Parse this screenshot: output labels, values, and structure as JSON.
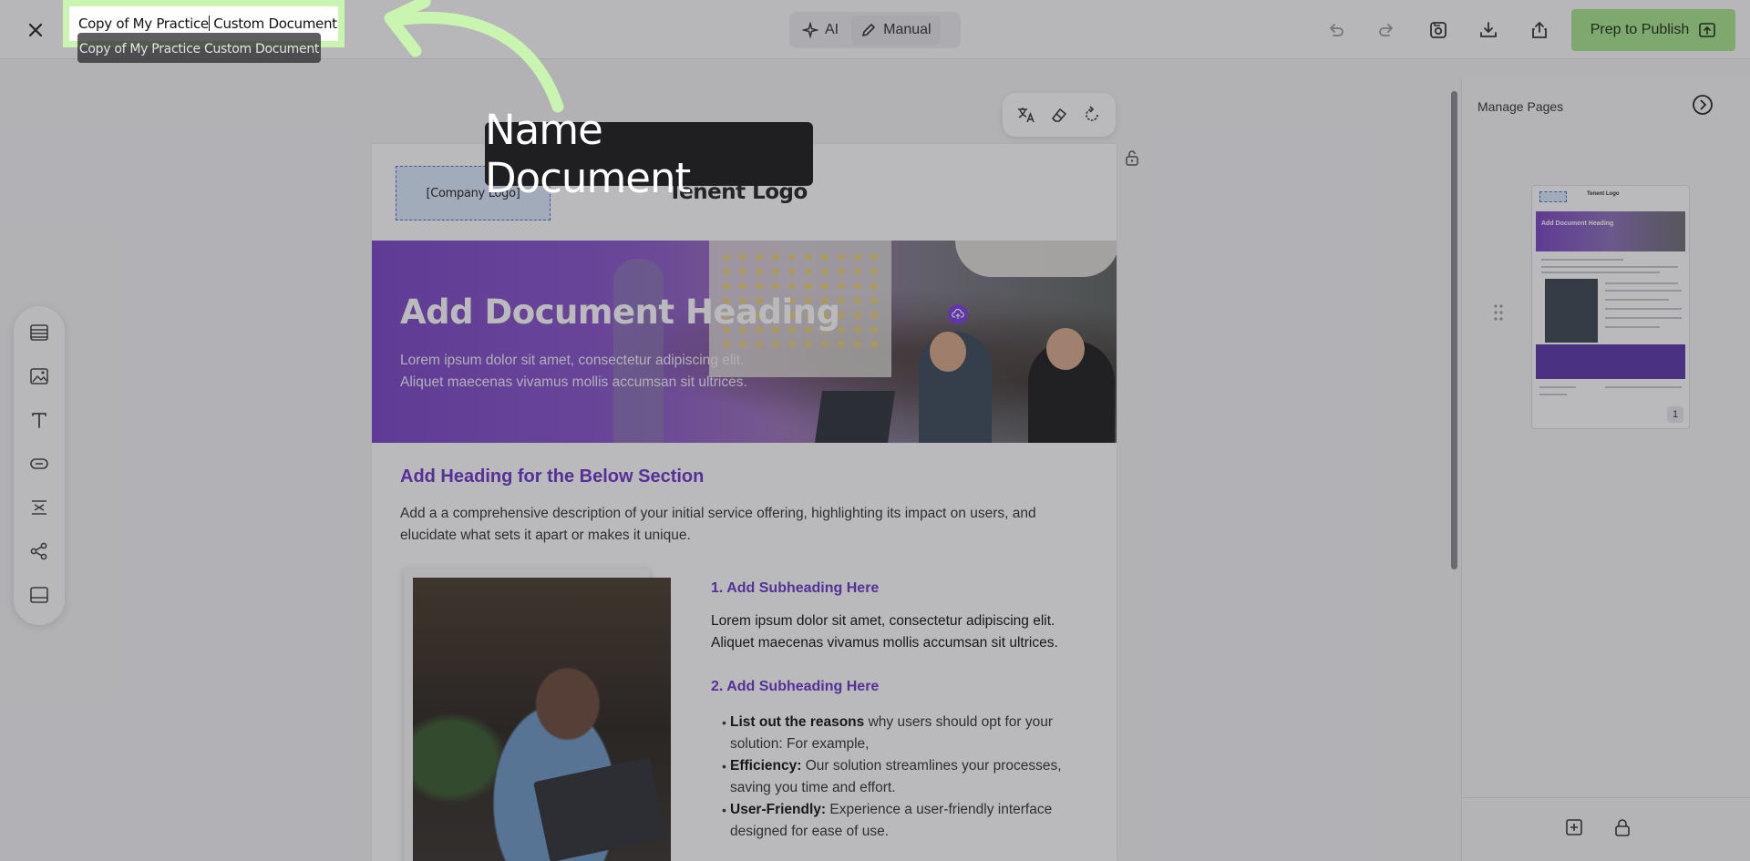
{
  "topbar": {
    "document_name": "Copy of My Practice Custom Document",
    "document_name_before_caret": "Copy of My Practice",
    "document_name_after_caret": " Custom Document",
    "tooltip": "Copy of My Practice Custom Document",
    "mode_ai_label": "AI",
    "mode_manual_label": "Manual",
    "publish_label": "Prep to Publish"
  },
  "callout": {
    "label": "Name Document"
  },
  "canvas": {
    "company_logo": "[Company Logo]",
    "tenant_logo": "Tenent Logo",
    "hero_title": "Add Document Heading",
    "hero_text": "Lorem ipsum dolor sit amet, consectetur adipiscing elit. Aliquet maecenas vivamus mollis accumsan sit ultrices.",
    "section_heading": "Add Heading for the Below Section",
    "section_desc": "Add a a comprehensive description of your initial service offering, highlighting its impact on users, and elucidate what sets it apart or makes it unique.",
    "sub1_title": "1. Add Subheading Here",
    "sub1_text": "Lorem ipsum dolor sit amet, consectetur adipiscing elit. Aliquet maecenas vivamus mollis accumsan sit ultrices.",
    "sub2_title": "2. Add Subheading Here",
    "bullets": [
      {
        "bold": "List out the reasons",
        "text": " why users should opt for your solution: For example,"
      },
      {
        "bold": "Efficiency:",
        "text": " Our solution streamlines your processes, saving you time and effort."
      },
      {
        "bold": "User-Friendly:",
        "text": " Experience a user-friendly interface designed for ease of use."
      }
    ]
  },
  "right_pane": {
    "title": "Manage Pages",
    "thumbnail_page_number": "1",
    "thumbnail_tenant": "Tenent Logo",
    "thumbnail_heading": "Add Document Heading"
  },
  "colors": {
    "accent": "#6b35c9",
    "publish": "#a7e58c",
    "highlight": "#c9f5b0"
  },
  "icons": {
    "close": "close-icon",
    "ai": "sparkle-icon",
    "manual": "pencil-icon",
    "undo": "undo-icon",
    "redo": "redo-icon",
    "save": "save-icon",
    "download": "download-icon",
    "share": "share-icon",
    "publish": "publish-icon",
    "tools": [
      "layout-icon",
      "image-icon",
      "text-icon",
      "button-icon",
      "spacer-icon",
      "share-nodes-icon",
      "footer-icon"
    ]
  }
}
